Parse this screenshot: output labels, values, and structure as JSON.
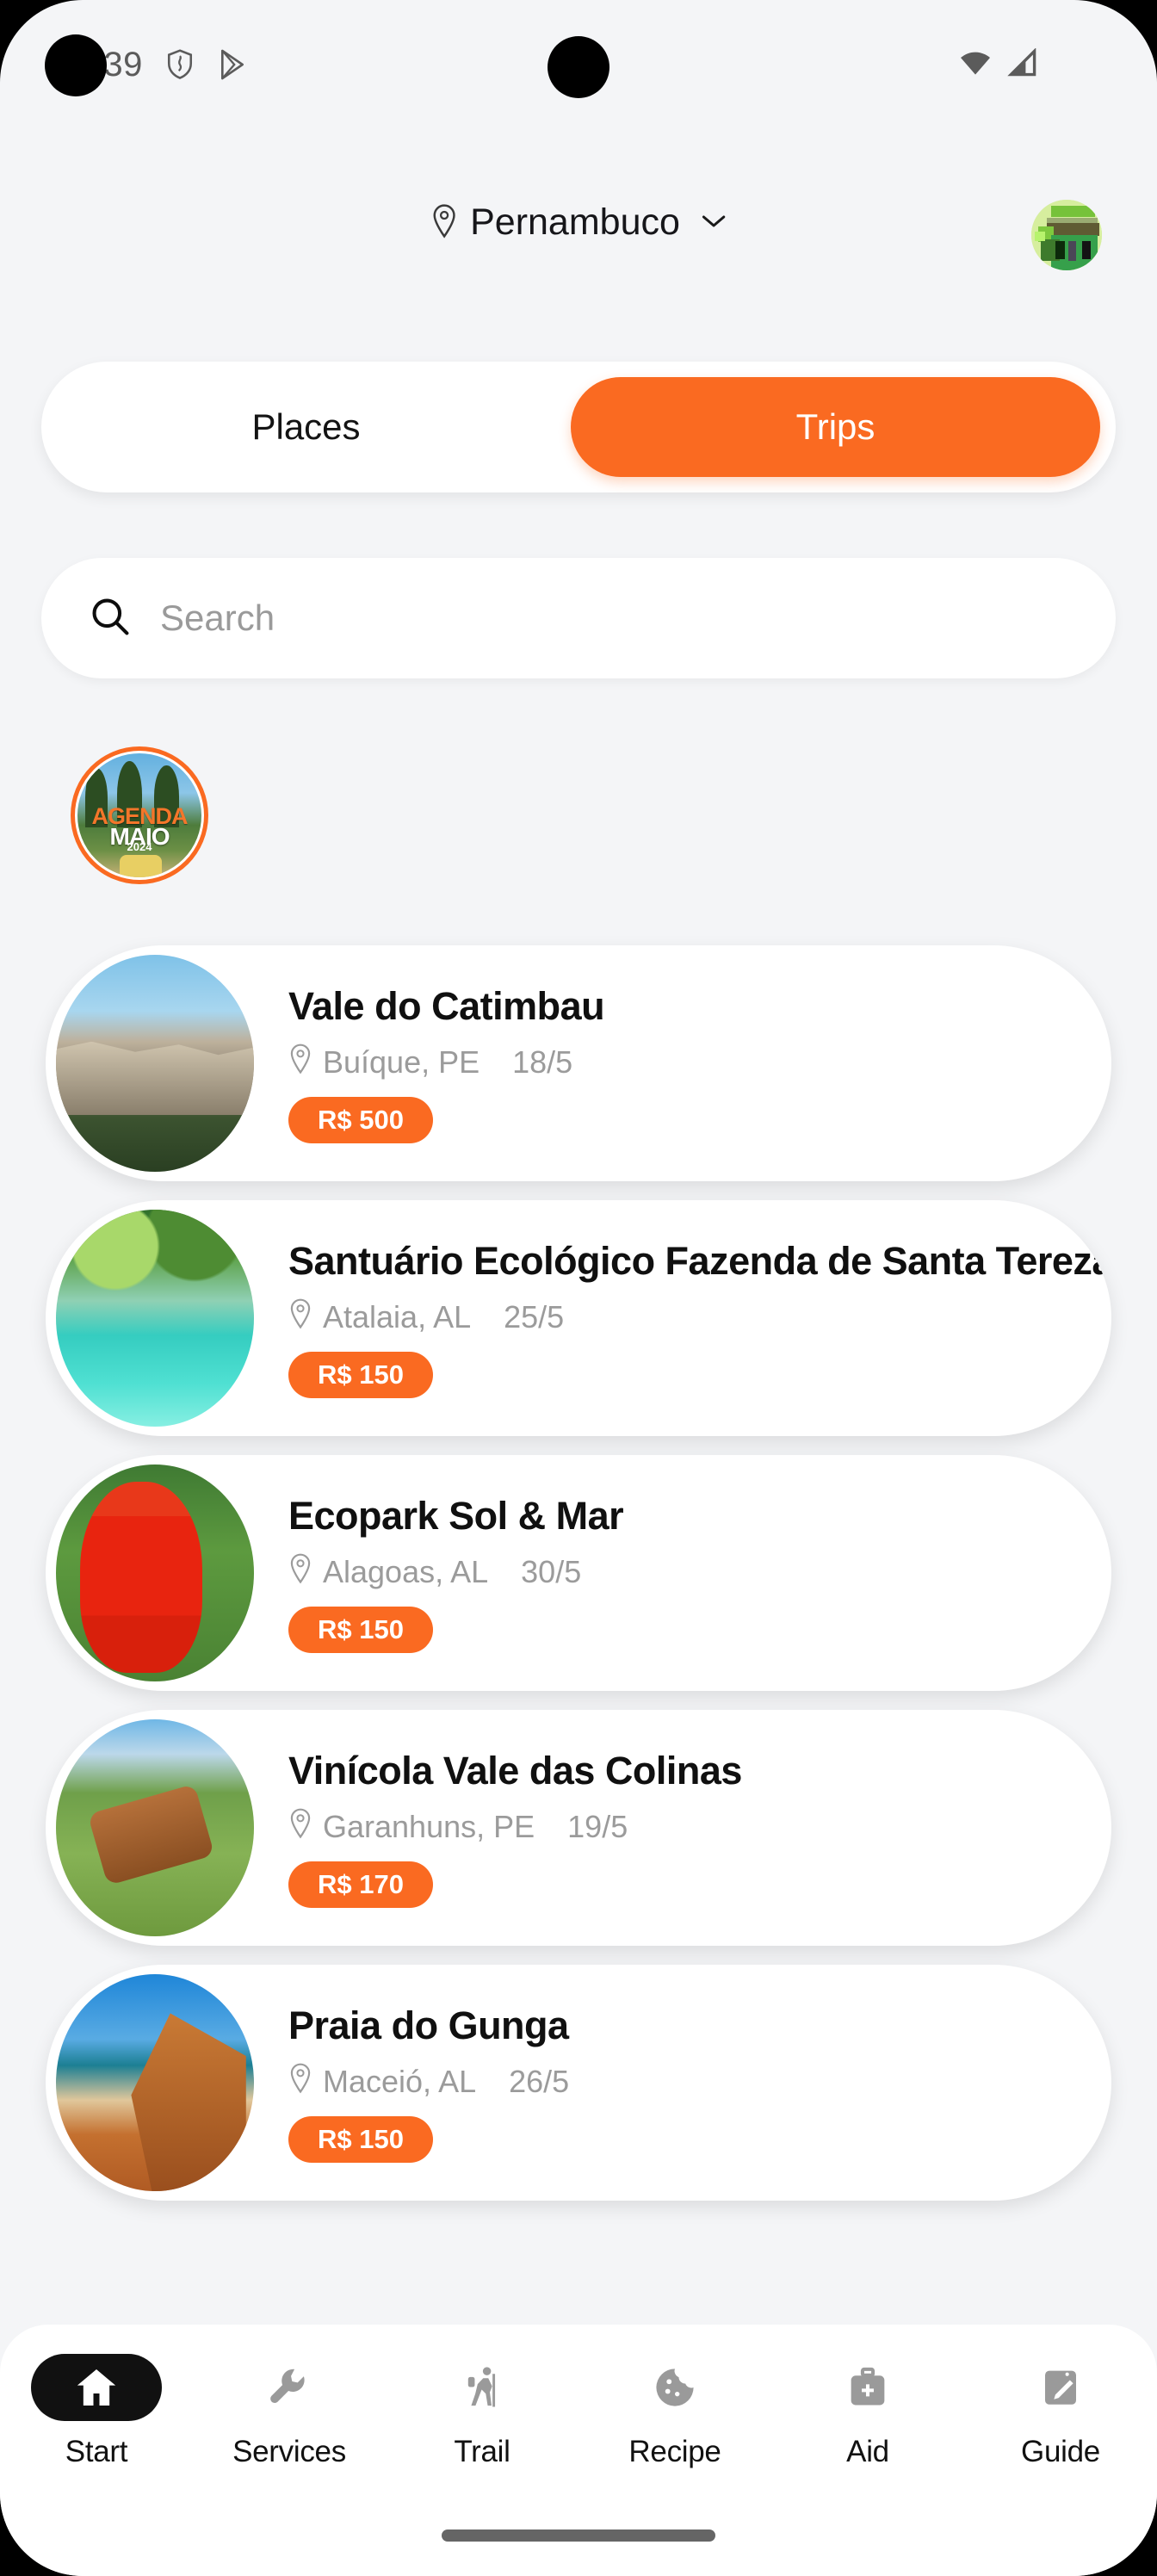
{
  "status_bar": {
    "time": "1:39",
    "icons": [
      "shield-icon",
      "play-store-icon",
      "wifi-icon",
      "cellular-signal-icon"
    ]
  },
  "header": {
    "location_label": "Pernambuco",
    "location_pin_icon": "map-pin-icon",
    "chevron_icon": "chevron-down-icon",
    "avatar_alt": "user-avatar"
  },
  "tabs": {
    "places_label": "Places",
    "trips_label": "Trips",
    "active": "Trips"
  },
  "search": {
    "value": "",
    "placeholder": "Search",
    "icon": "search-icon"
  },
  "stories": [
    {
      "id": "agenda-maio",
      "line1": "AGENDA",
      "line2": "MAIO",
      "line3": "2024"
    }
  ],
  "trips": [
    {
      "title": "Vale do Catimbau",
      "location": "Buíque, PE",
      "date": "18/5",
      "price": "R$ 500",
      "thumb_class": "t1"
    },
    {
      "title": "Santuário Ecológico Fazenda de Santa Tereza",
      "location": "Atalaia, AL",
      "date": "25/5",
      "price": "R$ 150",
      "thumb_class": "t2"
    },
    {
      "title": "Ecopark Sol & Mar",
      "location": "Alagoas, AL",
      "date": "30/5",
      "price": "R$ 150",
      "thumb_class": "t3"
    },
    {
      "title": "Vinícola Vale das Colinas",
      "location": "Garanhuns, PE",
      "date": "19/5",
      "price": "R$ 170",
      "thumb_class": "t4"
    },
    {
      "title": "Praia do Gunga",
      "location": "Maceió, AL",
      "date": "26/5",
      "price": "R$ 150",
      "thumb_class": "t5"
    }
  ],
  "bottom_nav": {
    "active": "Start",
    "items": [
      {
        "label": "Start",
        "icon": "home-icon"
      },
      {
        "label": "Services",
        "icon": "wrench-icon"
      },
      {
        "label": "Trail",
        "icon": "hiking-icon"
      },
      {
        "label": "Recipe",
        "icon": "cookie-icon"
      },
      {
        "label": "Aid",
        "icon": "medical-kit-icon"
      },
      {
        "label": "Guide",
        "icon": "clipboard-pencil-icon"
      }
    ]
  },
  "colors": {
    "accent": "#FA6A21",
    "background": "#F4F5F7",
    "card": "#FFFFFF",
    "muted_text": "#9B9B9B",
    "nav_active": "#111111"
  }
}
